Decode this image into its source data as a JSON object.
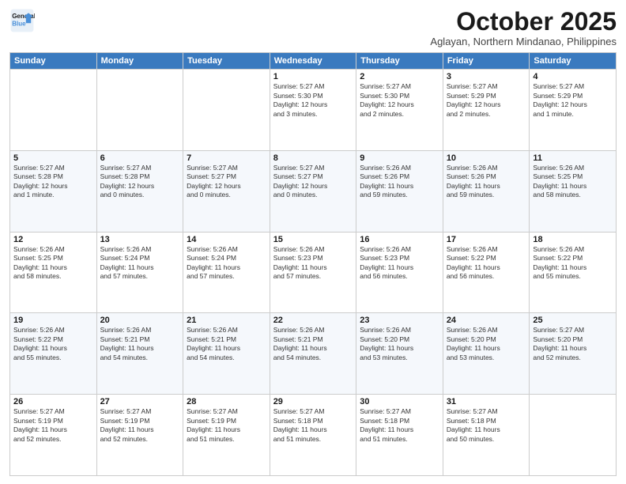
{
  "header": {
    "logo_line1": "General",
    "logo_line2": "Blue",
    "month_title": "October 2025",
    "location": "Aglayan, Northern Mindanao, Philippines"
  },
  "weekdays": [
    "Sunday",
    "Monday",
    "Tuesday",
    "Wednesday",
    "Thursday",
    "Friday",
    "Saturday"
  ],
  "weeks": [
    [
      {
        "day": "",
        "info": ""
      },
      {
        "day": "",
        "info": ""
      },
      {
        "day": "",
        "info": ""
      },
      {
        "day": "1",
        "info": "Sunrise: 5:27 AM\nSunset: 5:30 PM\nDaylight: 12 hours\nand 3 minutes."
      },
      {
        "day": "2",
        "info": "Sunrise: 5:27 AM\nSunset: 5:30 PM\nDaylight: 12 hours\nand 2 minutes."
      },
      {
        "day": "3",
        "info": "Sunrise: 5:27 AM\nSunset: 5:29 PM\nDaylight: 12 hours\nand 2 minutes."
      },
      {
        "day": "4",
        "info": "Sunrise: 5:27 AM\nSunset: 5:29 PM\nDaylight: 12 hours\nand 1 minute."
      }
    ],
    [
      {
        "day": "5",
        "info": "Sunrise: 5:27 AM\nSunset: 5:28 PM\nDaylight: 12 hours\nand 1 minute."
      },
      {
        "day": "6",
        "info": "Sunrise: 5:27 AM\nSunset: 5:28 PM\nDaylight: 12 hours\nand 0 minutes."
      },
      {
        "day": "7",
        "info": "Sunrise: 5:27 AM\nSunset: 5:27 PM\nDaylight: 12 hours\nand 0 minutes."
      },
      {
        "day": "8",
        "info": "Sunrise: 5:27 AM\nSunset: 5:27 PM\nDaylight: 12 hours\nand 0 minutes."
      },
      {
        "day": "9",
        "info": "Sunrise: 5:26 AM\nSunset: 5:26 PM\nDaylight: 11 hours\nand 59 minutes."
      },
      {
        "day": "10",
        "info": "Sunrise: 5:26 AM\nSunset: 5:26 PM\nDaylight: 11 hours\nand 59 minutes."
      },
      {
        "day": "11",
        "info": "Sunrise: 5:26 AM\nSunset: 5:25 PM\nDaylight: 11 hours\nand 58 minutes."
      }
    ],
    [
      {
        "day": "12",
        "info": "Sunrise: 5:26 AM\nSunset: 5:25 PM\nDaylight: 11 hours\nand 58 minutes."
      },
      {
        "day": "13",
        "info": "Sunrise: 5:26 AM\nSunset: 5:24 PM\nDaylight: 11 hours\nand 57 minutes."
      },
      {
        "day": "14",
        "info": "Sunrise: 5:26 AM\nSunset: 5:24 PM\nDaylight: 11 hours\nand 57 minutes."
      },
      {
        "day": "15",
        "info": "Sunrise: 5:26 AM\nSunset: 5:23 PM\nDaylight: 11 hours\nand 57 minutes."
      },
      {
        "day": "16",
        "info": "Sunrise: 5:26 AM\nSunset: 5:23 PM\nDaylight: 11 hours\nand 56 minutes."
      },
      {
        "day": "17",
        "info": "Sunrise: 5:26 AM\nSunset: 5:22 PM\nDaylight: 11 hours\nand 56 minutes."
      },
      {
        "day": "18",
        "info": "Sunrise: 5:26 AM\nSunset: 5:22 PM\nDaylight: 11 hours\nand 55 minutes."
      }
    ],
    [
      {
        "day": "19",
        "info": "Sunrise: 5:26 AM\nSunset: 5:22 PM\nDaylight: 11 hours\nand 55 minutes."
      },
      {
        "day": "20",
        "info": "Sunrise: 5:26 AM\nSunset: 5:21 PM\nDaylight: 11 hours\nand 54 minutes."
      },
      {
        "day": "21",
        "info": "Sunrise: 5:26 AM\nSunset: 5:21 PM\nDaylight: 11 hours\nand 54 minutes."
      },
      {
        "day": "22",
        "info": "Sunrise: 5:26 AM\nSunset: 5:21 PM\nDaylight: 11 hours\nand 54 minutes."
      },
      {
        "day": "23",
        "info": "Sunrise: 5:26 AM\nSunset: 5:20 PM\nDaylight: 11 hours\nand 53 minutes."
      },
      {
        "day": "24",
        "info": "Sunrise: 5:26 AM\nSunset: 5:20 PM\nDaylight: 11 hours\nand 53 minutes."
      },
      {
        "day": "25",
        "info": "Sunrise: 5:27 AM\nSunset: 5:20 PM\nDaylight: 11 hours\nand 52 minutes."
      }
    ],
    [
      {
        "day": "26",
        "info": "Sunrise: 5:27 AM\nSunset: 5:19 PM\nDaylight: 11 hours\nand 52 minutes."
      },
      {
        "day": "27",
        "info": "Sunrise: 5:27 AM\nSunset: 5:19 PM\nDaylight: 11 hours\nand 52 minutes."
      },
      {
        "day": "28",
        "info": "Sunrise: 5:27 AM\nSunset: 5:19 PM\nDaylight: 11 hours\nand 51 minutes."
      },
      {
        "day": "29",
        "info": "Sunrise: 5:27 AM\nSunset: 5:18 PM\nDaylight: 11 hours\nand 51 minutes."
      },
      {
        "day": "30",
        "info": "Sunrise: 5:27 AM\nSunset: 5:18 PM\nDaylight: 11 hours\nand 51 minutes."
      },
      {
        "day": "31",
        "info": "Sunrise: 5:27 AM\nSunset: 5:18 PM\nDaylight: 11 hours\nand 50 minutes."
      },
      {
        "day": "",
        "info": ""
      }
    ]
  ]
}
